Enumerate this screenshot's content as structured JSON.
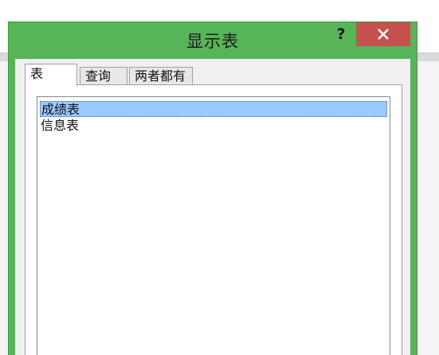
{
  "dialog": {
    "title": "显示表",
    "help_label": "?",
    "close_icon": "close-icon"
  },
  "tabs": [
    {
      "label": "表",
      "active": true
    },
    {
      "label": "查询",
      "active": false
    },
    {
      "label": "两者都有",
      "active": false
    }
  ],
  "list": {
    "items": [
      {
        "label": "成绩表",
        "selected": true
      },
      {
        "label": "信息表",
        "selected": false
      }
    ]
  },
  "colors": {
    "dialog_frame": "#56b556",
    "close_button": "#c75050",
    "selection": "#99c9ff"
  }
}
